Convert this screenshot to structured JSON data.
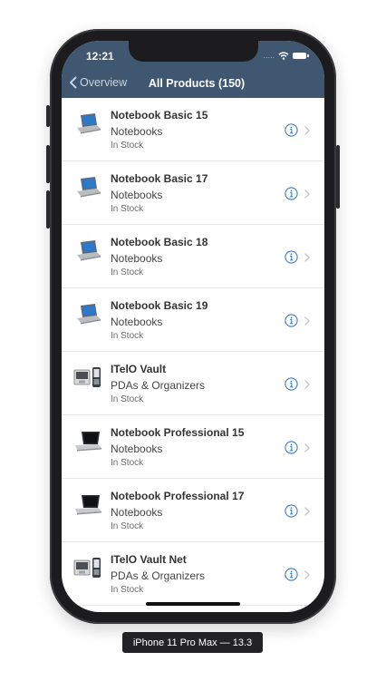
{
  "status_bar": {
    "time": "12:21",
    "signal_dots": "....."
  },
  "nav": {
    "back_label": "Overview",
    "title": "All Products (150)"
  },
  "products": [
    {
      "name": "Notebook Basic 15",
      "category": "Notebooks",
      "status": "In Stock",
      "icon": "laptop-basic-icon"
    },
    {
      "name": "Notebook Basic 17",
      "category": "Notebooks",
      "status": "In Stock",
      "icon": "laptop-basic-icon"
    },
    {
      "name": "Notebook Basic 18",
      "category": "Notebooks",
      "status": "In Stock",
      "icon": "laptop-basic-icon"
    },
    {
      "name": "Notebook Basic 19",
      "category": "Notebooks",
      "status": "In Stock",
      "icon": "laptop-basic-icon"
    },
    {
      "name": "ITelO Vault",
      "category": "PDAs & Organizers",
      "status": "In Stock",
      "icon": "pda-icon"
    },
    {
      "name": "Notebook Professional 15",
      "category": "Notebooks",
      "status": "In Stock",
      "icon": "laptop-professional-icon"
    },
    {
      "name": "Notebook Professional 17",
      "category": "Notebooks",
      "status": "In Stock",
      "icon": "laptop-professional-icon"
    },
    {
      "name": "ITelO Vault Net",
      "category": "PDAs & Organizers",
      "status": "In Stock",
      "icon": "pda-icon"
    }
  ],
  "device_label": "iPhone 11 Pro Max — 13.3",
  "colors": {
    "navbar": "#3f5770",
    "accent": "#2f7fd1",
    "chevron": "#c4c4c7"
  }
}
